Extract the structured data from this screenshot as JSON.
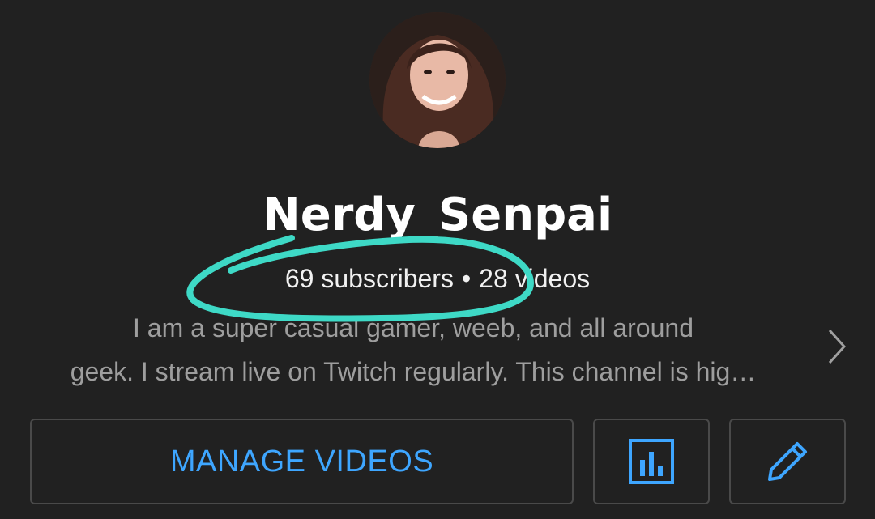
{
  "channel": {
    "name": "Nerdy_Senpai",
    "subscribers": "69 subscribers",
    "separator": "•",
    "videos": "28 videos",
    "description_line1": "I am a super casual gamer, weeb, and all around",
    "description_line2": "geek. I stream live on Twitch regularly. This channel is hig…"
  },
  "actions": {
    "manage_videos_label": "MANAGE VIDEOS",
    "analytics_icon": "analytics-icon",
    "edit_icon": "pencil-icon"
  },
  "colors": {
    "background": "#212121",
    "accent": "#3ea6ff",
    "highlight_ink": "#3ed9c6",
    "text_primary": "#ffffff",
    "text_secondary": "#9e9e9e"
  }
}
